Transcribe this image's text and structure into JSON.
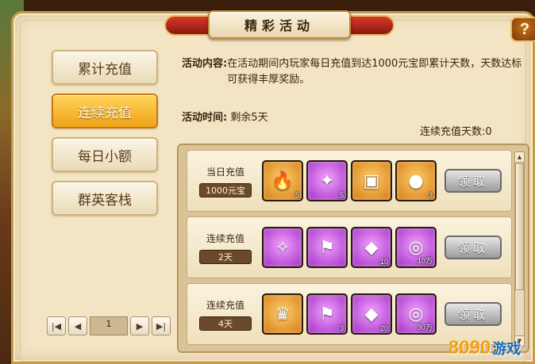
{
  "title": "精彩活动",
  "help_label": "?",
  "tabs": [
    {
      "label": "累计充值",
      "active": false
    },
    {
      "label": "连续充值",
      "active": true
    },
    {
      "label": "每日小额",
      "active": false
    },
    {
      "label": "群英客栈",
      "active": false
    }
  ],
  "pager": {
    "first": "|◀",
    "prev": "◀",
    "page": "1",
    "next": "▶",
    "last": "▶|"
  },
  "info": {
    "content_label": "活动内容:",
    "content_text": "在活动期间内玩家每日充值到达1000元宝即累计天数，天数达标可获得丰厚奖励。",
    "time_label": "活动时间:",
    "time_text": "剩余5天",
    "days_count": "连续充值天数:0"
  },
  "rows": [
    {
      "label": "当日充值",
      "value": "1000元宝",
      "items": [
        {
          "icon": "fire-gem-icon",
          "color": "orange",
          "qty": "5"
        },
        {
          "icon": "scroll-orb-icon",
          "color": "purple",
          "qty": "5"
        },
        {
          "icon": "treasure-chest-icon",
          "color": "orange",
          "qty": ""
        },
        {
          "icon": "pouch-icon",
          "color": "orange",
          "qty": "3"
        }
      ],
      "claim": "领取"
    },
    {
      "label": "连续充值",
      "value": "2天",
      "items": [
        {
          "icon": "rune-card-icon",
          "color": "purple",
          "qty": ""
        },
        {
          "icon": "flag-icon",
          "color": "purple",
          "qty": ""
        },
        {
          "icon": "cape-icon",
          "color": "purple",
          "qty": "10"
        },
        {
          "icon": "gold-ring-icon",
          "color": "purple",
          "qty": "10万"
        }
      ],
      "claim": "领取"
    },
    {
      "label": "连续充值",
      "value": "4天",
      "items": [
        {
          "icon": "golden-helmet-icon",
          "color": "orange",
          "qty": ""
        },
        {
          "icon": "flag-icon",
          "color": "purple",
          "qty": "3"
        },
        {
          "icon": "cape-icon",
          "color": "purple",
          "qty": "20"
        },
        {
          "icon": "gold-ring-icon",
          "color": "purple",
          "qty": "30万"
        }
      ],
      "claim": "领取"
    }
  ],
  "watermark": {
    "num": "8090",
    "text": "游戏"
  }
}
